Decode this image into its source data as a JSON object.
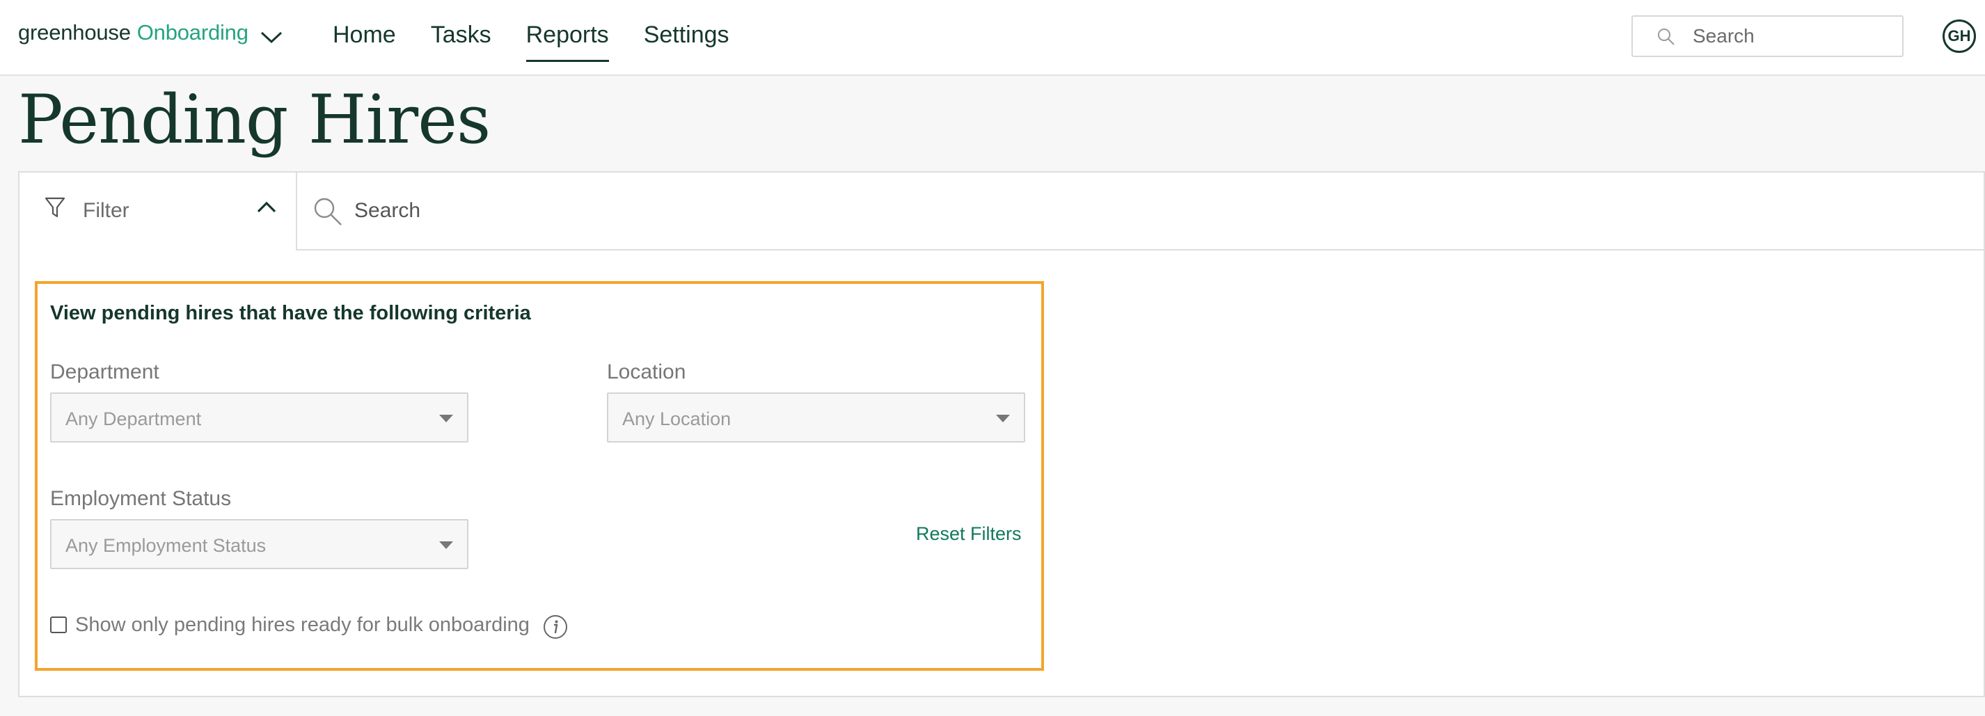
{
  "nav": {
    "brand": "greenhouse",
    "product": "Onboarding",
    "links": [
      {
        "label": "Home",
        "active": false
      },
      {
        "label": "Tasks",
        "active": false
      },
      {
        "label": "Reports",
        "active": true
      },
      {
        "label": "Settings",
        "active": false
      }
    ],
    "search_placeholder": "Search",
    "avatar_initials": "GH"
  },
  "page": {
    "title": "Pending Hires"
  },
  "toolbar": {
    "filter_label": "Filter",
    "search_placeholder": "Search"
  },
  "criteria": {
    "title": "View pending hires that have the following criteria",
    "department_label": "Department",
    "department_value": "Any Department",
    "location_label": "Location",
    "location_value": "Any Location",
    "employment_label": "Employment Status",
    "employment_value": "Any Employment Status",
    "reset_label": "Reset Filters",
    "bulk_label": "Show only pending hires ready for bulk onboarding",
    "bulk_checked": false
  },
  "colors": {
    "brand_dark": "#15372c",
    "brand_green": "#24a47f",
    "link_green": "#12795b",
    "highlight_orange": "#f4a42c"
  },
  "icons": [
    "chevron-down-icon",
    "search-icon",
    "funnel-icon",
    "chevron-up-icon",
    "caret-down-icon",
    "info-icon"
  ]
}
